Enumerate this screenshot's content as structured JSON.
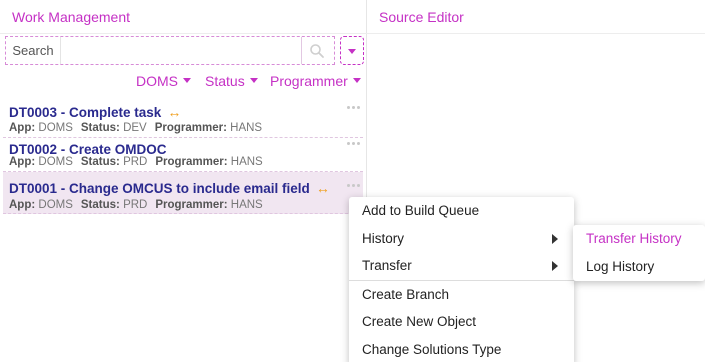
{
  "left_panel": {
    "title": "Work Management",
    "search": {
      "label": "Search",
      "value": "",
      "placeholder": ""
    },
    "filters": [
      {
        "label": "DOMS"
      },
      {
        "label": "Status"
      },
      {
        "label": "Programmer"
      }
    ],
    "tasks": [
      {
        "title": "DT0003 - Complete task",
        "has_transfer_icon": true,
        "app_label": "App:",
        "app": "DOMS",
        "status_label": "Status:",
        "status": "DEV",
        "programmer_label": "Programmer:",
        "programmer": "HANS",
        "selected": false
      },
      {
        "title": "DT0002 - Create OMDOC",
        "has_transfer_icon": false,
        "app_label": "App:",
        "app": "DOMS",
        "status_label": "Status:",
        "status": "PRD",
        "programmer_label": "Programmer:",
        "programmer": "HANS",
        "selected": false
      },
      {
        "title": "DT0001 - Change OMCUS to include email field",
        "has_transfer_icon": true,
        "app_label": "App:",
        "app": "DOMS",
        "status_label": "Status:",
        "status": "PRD",
        "programmer_label": "Programmer:",
        "programmer": "HANS",
        "selected": true
      }
    ]
  },
  "right_panel": {
    "title": "Source Editor"
  },
  "context_menu": {
    "items": [
      {
        "label": "Add to Build Queue",
        "has_submenu": false
      },
      {
        "label": "History",
        "has_submenu": true
      },
      {
        "label": "Transfer",
        "has_submenu": true
      },
      {
        "label": "Create Branch",
        "has_submenu": false
      },
      {
        "label": "Create New Object",
        "has_submenu": false
      },
      {
        "label": "Change Solutions Type",
        "has_submenu": false
      }
    ]
  },
  "submenu": {
    "items": [
      {
        "label": "Transfer History",
        "active": true
      },
      {
        "label": "Log History",
        "active": false
      }
    ]
  },
  "colors": {
    "accent": "#c531c5",
    "task_title": "#2a2a8e",
    "transfer_icon": "#f0a020",
    "selected_row": "#f1e6f1"
  },
  "icons": {
    "search": "search-icon",
    "transfer": "transfer-arrows-icon",
    "more": "more-options-icon"
  }
}
